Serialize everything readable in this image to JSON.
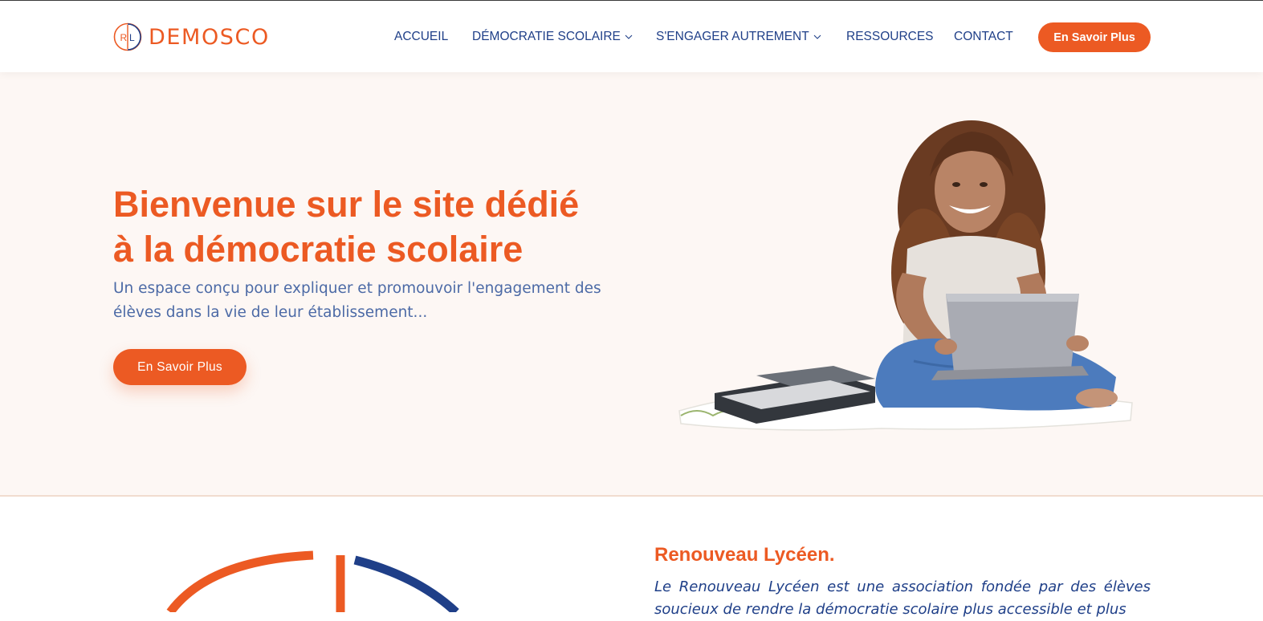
{
  "brand": {
    "name": "DEMOSCO",
    "mark": "RL"
  },
  "nav": {
    "items": [
      {
        "label": "ACCUEIL",
        "has_dropdown": false
      },
      {
        "label": "DÉMOCRATIE SCOLAIRE",
        "has_dropdown": true
      },
      {
        "label": "S'ENGAGER AUTREMENT",
        "has_dropdown": true
      },
      {
        "label": "RESSOURCES",
        "has_dropdown": false
      },
      {
        "label": "CONTACT",
        "has_dropdown": false
      }
    ],
    "cta_label": "En Savoir Plus"
  },
  "hero": {
    "title_line1": "Bienvenue sur le site dédié",
    "title_line2": "à la démocratie scolaire",
    "subtitle": "Un espace conçu pour expliquer et promouvoir l'engagement des élèves dans la vie de leur établissement...",
    "cta_label": "En Savoir Plus"
  },
  "about": {
    "title": "Renouveau Lycéen.",
    "text": "Le Renouveau Lycéen est une association fondée par des élèves soucieux de rendre la démocratie scolaire plus accessible et plus"
  },
  "colors": {
    "accent": "#ec5a23",
    "navy": "#1f3f88",
    "hero_bg": "#fdf7f4"
  }
}
